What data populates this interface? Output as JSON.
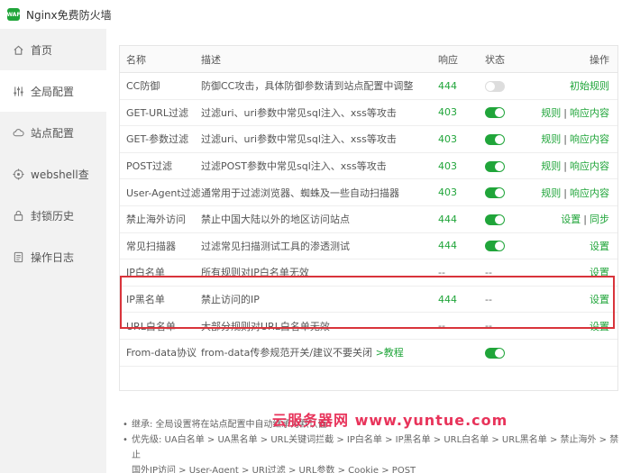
{
  "app": {
    "title": "Nginx免费防火墙",
    "logo_text": "WAF"
  },
  "sidebar": {
    "items": [
      {
        "label": "首页",
        "icon": "home-icon"
      },
      {
        "label": "全局配置",
        "icon": "sliders-icon",
        "active": true
      },
      {
        "label": "站点配置",
        "icon": "cloud-icon"
      },
      {
        "label": "webshell查",
        "icon": "target-icon"
      },
      {
        "label": "封锁历史",
        "icon": "lock-icon"
      },
      {
        "label": "操作日志",
        "icon": "log-icon"
      }
    ]
  },
  "table": {
    "headers": {
      "name": "名称",
      "desc": "描述",
      "resp": "响应",
      "state": "状态",
      "op": "操作"
    },
    "rows": [
      {
        "name": "CC防御",
        "desc": "防御CC攻击，具体防御参数请到站点配置中调整",
        "resp": "444",
        "state": "off",
        "op1": "初始规则",
        "op2": ""
      },
      {
        "name": "GET-URL过滤",
        "desc": "过滤uri、uri参数中常见sql注入、xss等攻击",
        "resp": "403",
        "state": "on",
        "op1": "规则",
        "op2": "响应内容"
      },
      {
        "name": "GET-参数过滤",
        "desc": "过滤uri、uri参数中常见sql注入、xss等攻击",
        "resp": "403",
        "state": "on",
        "op1": "规则",
        "op2": "响应内容"
      },
      {
        "name": "POST过滤",
        "desc": "过滤POST参数中常见sql注入、xss等攻击",
        "resp": "403",
        "state": "on",
        "op1": "规则",
        "op2": "响应内容"
      },
      {
        "name": "User-Agent过滤",
        "desc": "通常用于过滤浏览器、蜘蛛及一些自动扫描器",
        "resp": "403",
        "state": "on",
        "op1": "规则",
        "op2": "响应内容"
      },
      {
        "name": "禁止海外访问",
        "desc": "禁止中国大陆以外的地区访问站点",
        "resp": "444",
        "state": "on",
        "op1": "设置",
        "op2": "同步"
      },
      {
        "name": "常见扫描器",
        "desc": "过滤常见扫描测试工具的渗透测试",
        "resp": "444",
        "state": "on",
        "op1": "设置",
        "op2": ""
      },
      {
        "name": "IP白名单",
        "desc": "所有规则对IP白名单无效",
        "resp": "--",
        "state": "--",
        "op1": "设置",
        "op2": ""
      },
      {
        "name": "IP黑名单",
        "desc": "禁止访问的IP",
        "resp": "444",
        "state": "--",
        "op1": "设置",
        "op2": ""
      },
      {
        "name": "URL白名单",
        "desc": "大部分规则对URL白名单无效",
        "resp": "--",
        "state": "--",
        "op1": "设置",
        "op2": ""
      },
      {
        "name": "From-data协议",
        "desc": "from-data传参规范开关/建议不要关闭",
        "desc_link": ">教程",
        "resp": "",
        "state": "on",
        "op1": "",
        "op2": ""
      }
    ]
  },
  "notes": {
    "n1": "继承: 全局设置将在站点配置中自动继承为默认值",
    "n2": "优先级: UA白名单 > UA黑名单 > URL关键词拦截 > IP白名单 > IP黑名单 > URL白名单 > URL黑名单 > 禁止海外 > 禁止",
    "n3": "国外IP访问 > User-Agent > URI过滤 > URL参数 > Cookie > POST"
  },
  "watermark": "云服务器网 www.yuntue.com",
  "colors": {
    "accent": "#20a53a",
    "highlight": "#d9343b",
    "sidebar_bg": "#f2f2f2"
  }
}
